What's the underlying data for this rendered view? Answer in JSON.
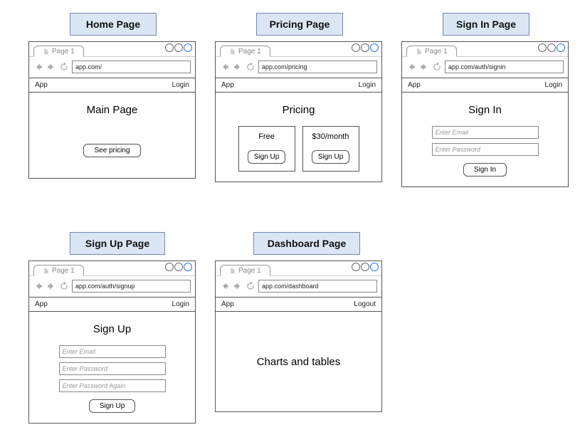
{
  "titles": {
    "home": "Home Page",
    "pricing": "Pricing Page",
    "signin": "Sign In Page",
    "signup": "Sign Up Page",
    "dashboard": "Dashboard Page"
  },
  "tabLabel": "Page 1",
  "urls": {
    "home": "app.com/",
    "pricing": "app.com/pricing",
    "signin": "app.com/auth/signin",
    "signup": "app.com/auth/signup",
    "dashboard": "app.com/dashboard"
  },
  "menu": {
    "app": "App",
    "login": "Login",
    "logout": "Logout"
  },
  "home": {
    "heading": "Main Page",
    "cta": "See pricing"
  },
  "pricing": {
    "heading": "Pricing",
    "plans": [
      {
        "name": "Free",
        "cta": "Sign Up"
      },
      {
        "name": "$30/month",
        "cta": "Sign Up"
      }
    ]
  },
  "signin": {
    "heading": "Sign In",
    "emailPlaceholder": "Enter Email",
    "passwordPlaceholder": "Enter Password",
    "submit": "Sign In"
  },
  "signup": {
    "heading": "Sign Up",
    "emailPlaceholder": "Enter Email",
    "passwordPlaceholder": "Enter Password",
    "confirmPlaceholder": "Enter Password Again",
    "submit": "Sign Up"
  },
  "dashboard": {
    "body": "Charts and tables"
  }
}
